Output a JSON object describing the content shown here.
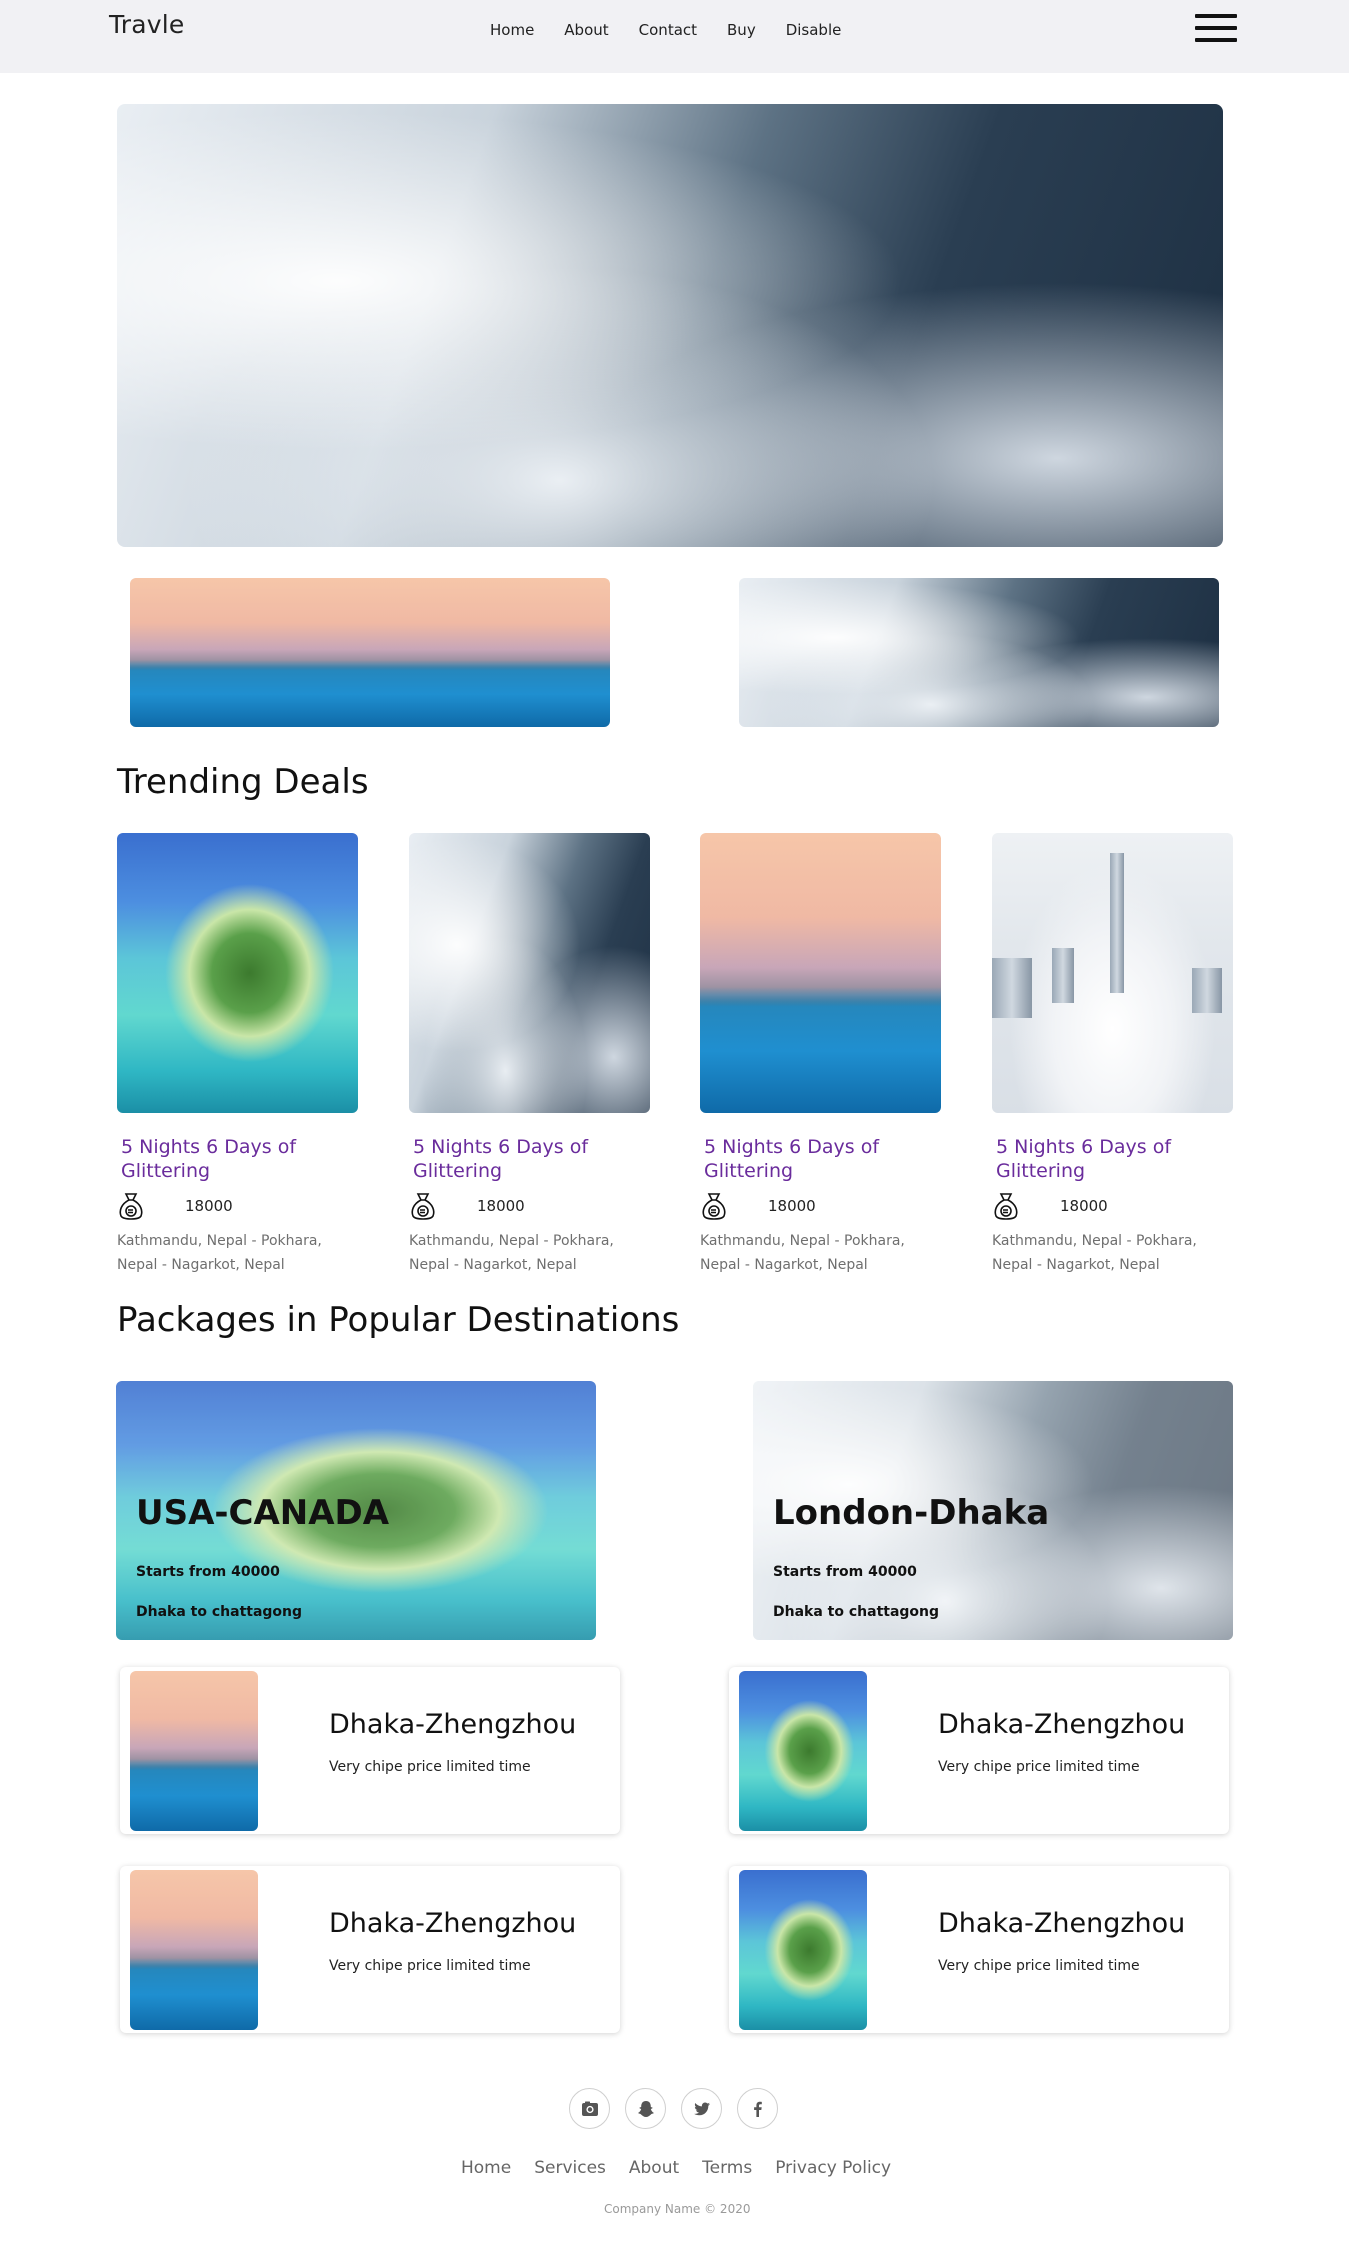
{
  "navbar": {
    "brand": "Travle",
    "links": [
      "Home",
      "About",
      "Contact",
      "Buy",
      "Disable"
    ],
    "menu_icon": "hamburger-icon"
  },
  "trending": {
    "title": "Trending Deals",
    "deals": [
      {
        "title": "5 Nights 6 Days of Glittering",
        "price": "18000",
        "location": "Kathmandu, Nepal - Pokhara, Nepal - Nagarkot, Nepal",
        "image": "island"
      },
      {
        "title": "5 Nights 6 Days of Glittering",
        "price": "18000",
        "location": "Kathmandu, Nepal - Pokhara, Nepal - Nagarkot, Nepal",
        "image": "fog"
      },
      {
        "title": "5 Nights 6 Days of Glittering",
        "price": "18000",
        "location": "Kathmandu, Nepal - Pokhara, Nepal - Nagarkot, Nepal",
        "image": "pool"
      },
      {
        "title": "5 Nights 6 Days of Glittering",
        "price": "18000",
        "location": "Kathmandu, Nepal - Pokhara, Nepal - Nagarkot, Nepal",
        "image": "city"
      }
    ],
    "price_icon": "money-bag-euro-icon"
  },
  "packages": {
    "title": "Packages in Popular Destinations",
    "featured": [
      {
        "name": "USA-CANADA",
        "starts": "Starts from 40000",
        "route": "Dhaka to chattagong",
        "image": "island"
      },
      {
        "name": "London-Dhaka",
        "starts": "Starts from 40000",
        "route": "Dhaka to chattagong",
        "image": "fog"
      }
    ],
    "offers": [
      {
        "title": "Dhaka-Zhengzhou",
        "subtitle": "Very chipe price limited time",
        "image": "pool"
      },
      {
        "title": "Dhaka-Zhengzhou",
        "subtitle": "Very chipe price limited time",
        "image": "island"
      },
      {
        "title": "Dhaka-Zhengzhou",
        "subtitle": "Very chipe price limited time",
        "image": "pool"
      },
      {
        "title": "Dhaka-Zhengzhou",
        "subtitle": "Very chipe price limited time",
        "image": "island"
      }
    ]
  },
  "footer": {
    "social_icons": [
      "instagram-icon",
      "snapchat-icon",
      "twitter-icon",
      "facebook-icon"
    ],
    "links": [
      "Home",
      "Services",
      "About",
      "Terms",
      "Privacy Policy"
    ],
    "copyright": "Company Name © 2020"
  },
  "colors": {
    "navbar_bg": "#f1f1f4",
    "deal_title": "#6a2c9c",
    "muted_text": "#6f6f6f"
  }
}
